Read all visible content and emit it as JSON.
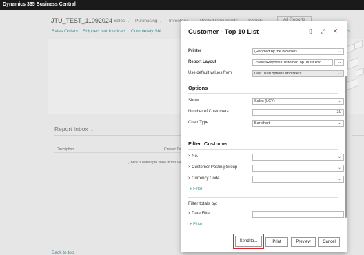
{
  "app": {
    "title": "Dynamics 365 Business Central"
  },
  "background": {
    "company": "JTU_TEST_11092024",
    "nav": [
      "Sales",
      "Purchasing",
      "Inventory",
      "Posted Documents",
      "Shopify"
    ],
    "all_reports": "All Reports",
    "subnav": [
      "Sales Orders",
      "Shipped Not Invoiced",
      "Completely Shi..."
    ],
    "right_links": "tks",
    "report_inbox": "Report Inbox",
    "col_description": "Description",
    "col_created": "Created Da",
    "empty_message": "(There is nothing to show in this view)",
    "back_to_top": "Back to top"
  },
  "dialog": {
    "title": "Customer - Top 10 List",
    "icons": [
      "page-icon",
      "expand-icon",
      "close-icon"
    ],
    "printer_label": "Printer",
    "printer_value": "(Handled by the browser)",
    "layout_label": "Report Layout",
    "layout_value": "./Sales/Reports/CustomerTop10List.rdlc",
    "layout_btn": "...",
    "defaults_label": "Use default values from",
    "defaults_value": "Last used options and filters",
    "options_heading": "Options",
    "show_label": "Show",
    "show_value": "Sales (LCY)",
    "num_label": "Number of Customers",
    "num_value": "10",
    "chart_label": "Chart Type",
    "chart_value": "Bar chart",
    "filter_heading": "Filter: Customer",
    "filter1_label": "× No.",
    "filter2_label": "× Customer Posting Group",
    "filter3_label": "× Currency Code",
    "add_filter": "+ Filter...",
    "totals_heading": "Filter totals by:",
    "date_filter_label": "× Date Filter",
    "add_filter2": "+ Filter...",
    "send_to": "Send to...",
    "print": "Print",
    "preview": "Preview",
    "cancel": "Cancel"
  },
  "colors": {
    "accent": "#3a8c8c",
    "highlight": "#e0242b",
    "topbar": "#1a1a1a"
  }
}
